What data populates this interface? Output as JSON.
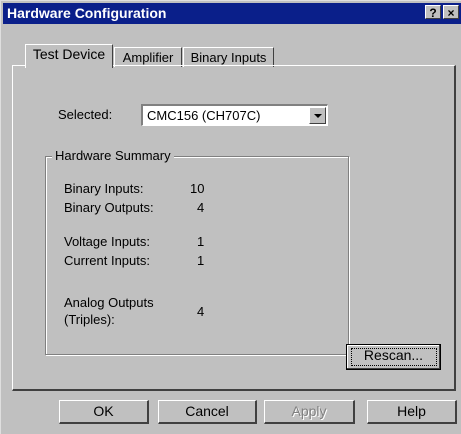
{
  "window": {
    "title": "Hardware Configuration",
    "help_glyph": "?",
    "close_glyph": "×"
  },
  "tabs": [
    {
      "label": "Test Device",
      "active": true
    },
    {
      "label": "Amplifier",
      "active": false
    },
    {
      "label": "Binary Inputs",
      "active": false
    }
  ],
  "selected": {
    "label": "Selected:",
    "value": "CMC156 (CH707C)"
  },
  "summary": {
    "title": "Hardware Summary",
    "rows": [
      {
        "label": "Binary Inputs:",
        "value": "10"
      },
      {
        "label": "Binary Outputs:",
        "value": "4"
      },
      {
        "label": "Voltage Inputs:",
        "value": "1"
      },
      {
        "label": "Current Inputs:",
        "value": "1"
      },
      {
        "label_line1": "Analog Outputs",
        "label_line2": "(Triples):",
        "value": "4"
      }
    ]
  },
  "buttons": {
    "rescan": "Rescan...",
    "ok": "OK",
    "cancel": "Cancel",
    "apply": "Apply",
    "help": "Help"
  }
}
